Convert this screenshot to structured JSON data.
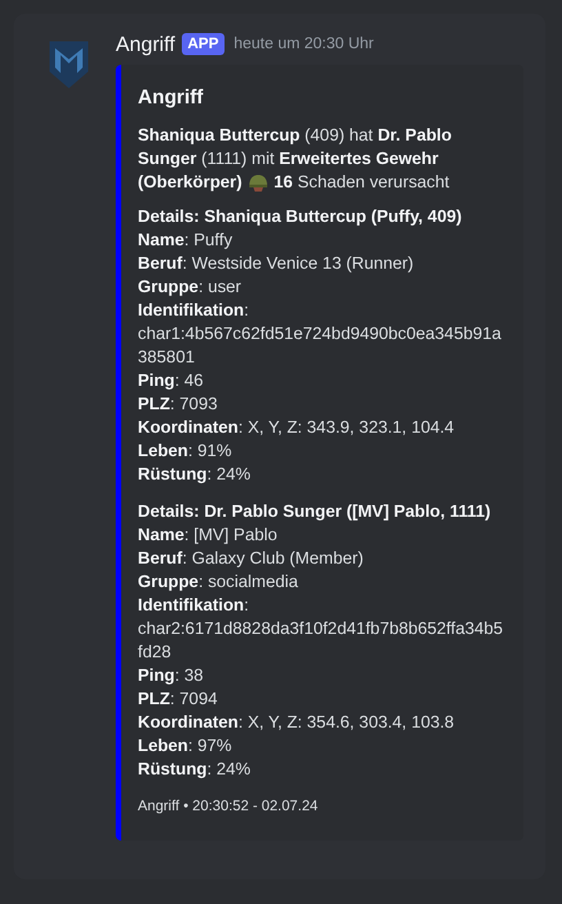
{
  "message": {
    "author": "Angriff",
    "badge": "APP",
    "timestamp": "heute um 20:30 Uhr"
  },
  "embed": {
    "color": "#0000ff",
    "title": "Angriff",
    "description_before": "**Shaniqua Buttercup** (409) hat **Dr. Pablo Sunger** (1111) mit **Erweitertes Gewehr**",
    "description_middle": "(Oberkörper)",
    "description_after": "**16** Schaden verursacht",
    "sections": [
      {
        "heading": "Details: Shaniqua Buttercup (Puffy, 409)",
        "lines": [
          "**Name**: Puffy",
          "**Beruf**: Westside Venice 13 (Runner)",
          "**Gruppe**: user",
          "**Identifikation**:",
          "char1:4b567c62fd51e724bd9490bc0ea345b91a385801",
          "**Ping**: 46",
          "**PLZ**: 7093",
          "**Koordinaten**: X, Y, Z: 343.9, 323.1, 104.4",
          "**Leben**: 91%",
          "**Rüstung**: 24%"
        ]
      },
      {
        "heading": "Details: Dr. Pablo Sunger ([MV] Pablo, 1111)",
        "lines": [
          "**Name**: [MV] Pablo",
          "**Beruf**: Galaxy Club (Member)",
          "**Gruppe**: socialmedia",
          "**Identifikation**:",
          "char2:6171d8828da3f10f2d41fb7b8b652ffa34b5fd28",
          "**Ping**: 38",
          "**PLZ**: 7094",
          "**Koordinaten**: X, Y, Z: 354.6, 303.4, 103.8",
          "**Leben**: 97%",
          "**Rüstung**: 24%"
        ]
      }
    ],
    "footer": "Angriff • 20:30:52 - 02.07.24"
  }
}
